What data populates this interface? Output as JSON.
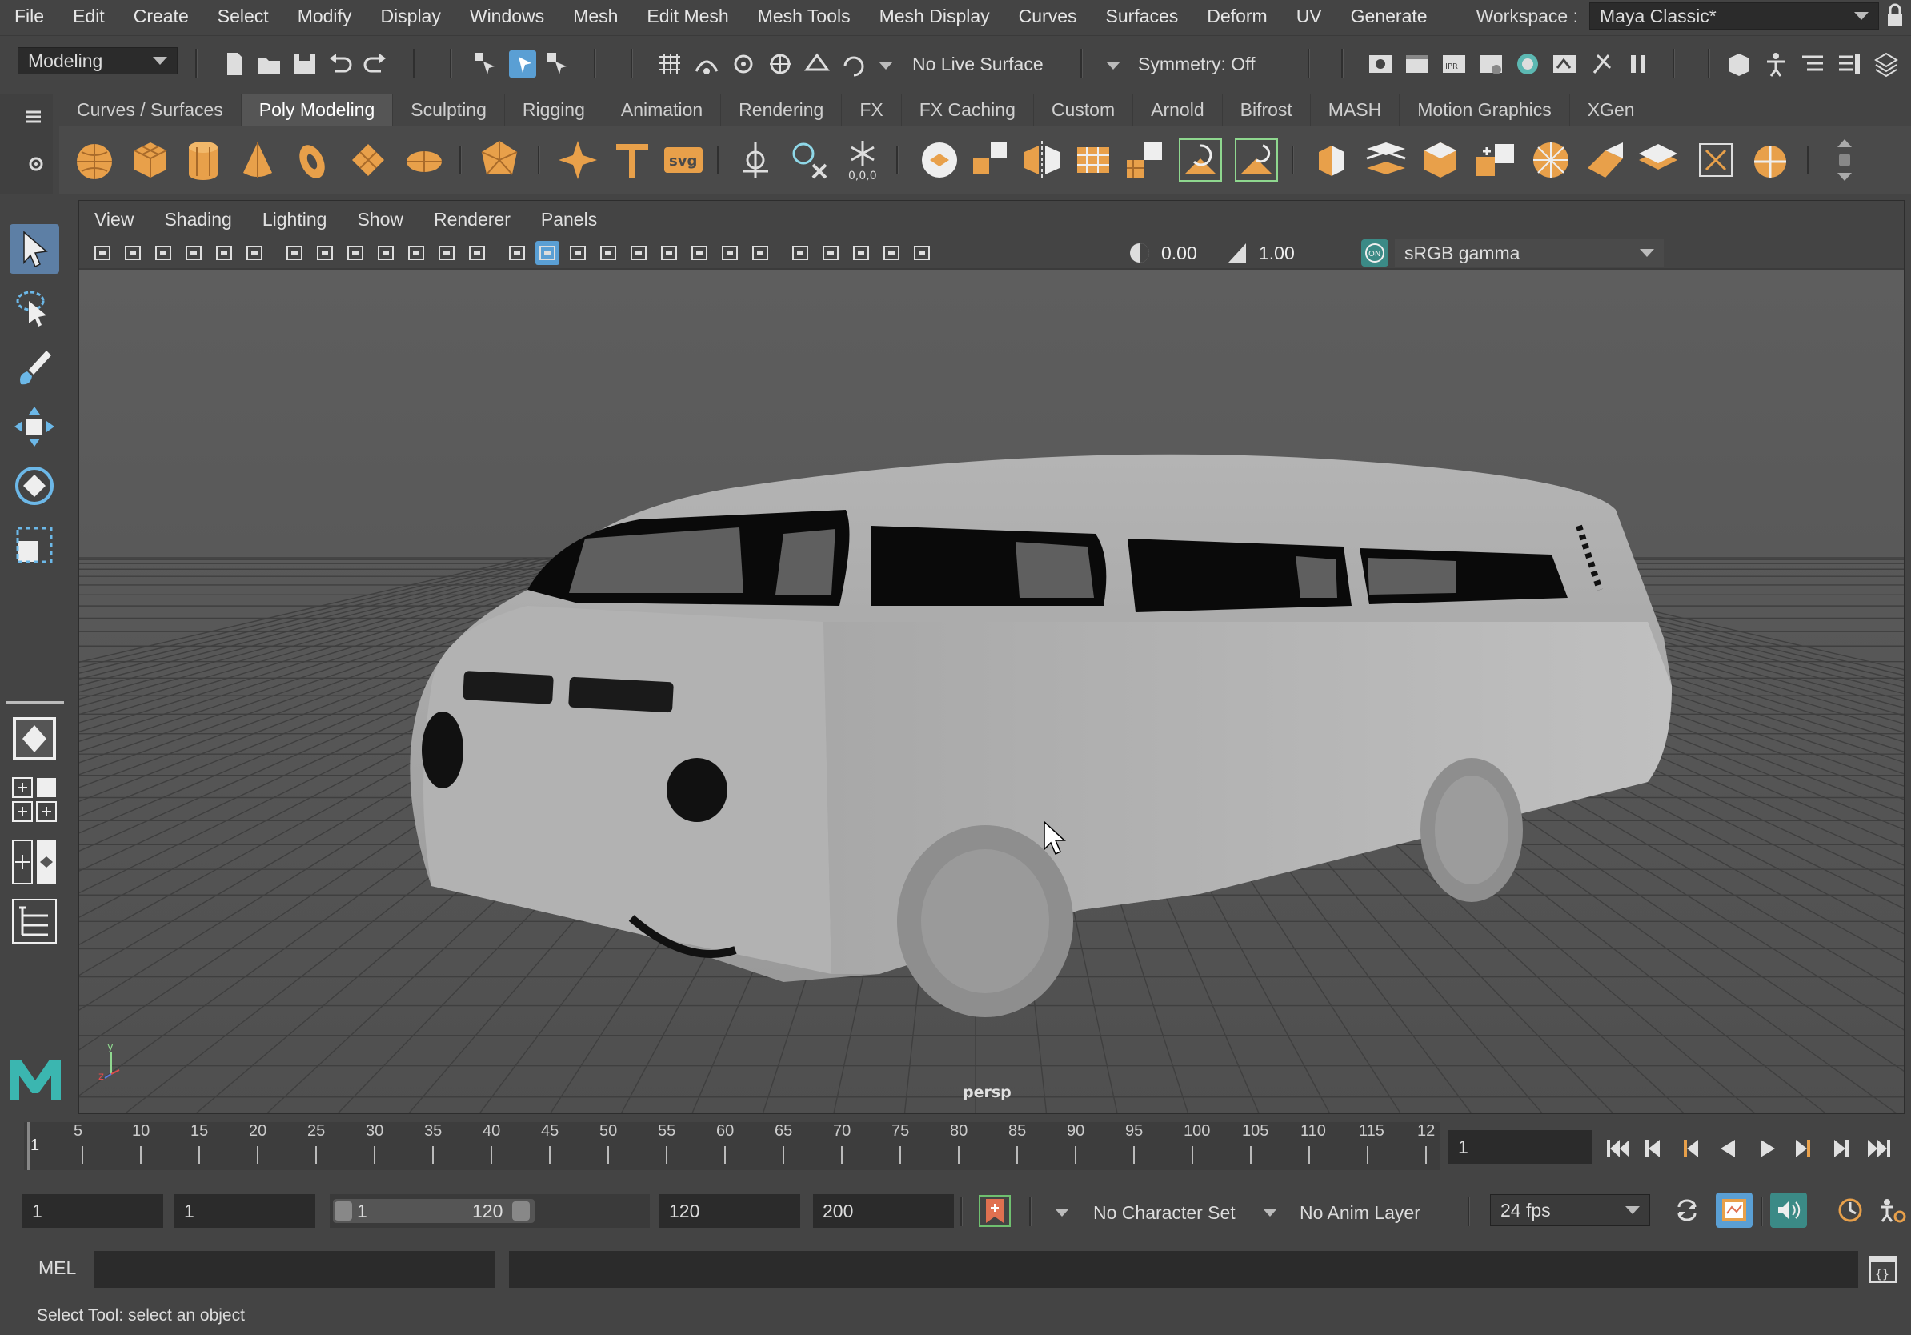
{
  "menubar": {
    "items": [
      "File",
      "Edit",
      "Create",
      "Select",
      "Modify",
      "Display",
      "Windows",
      "Mesh",
      "Edit Mesh",
      "Mesh Tools",
      "Mesh Display",
      "Curves",
      "Surfaces",
      "Deform",
      "UV",
      "Generate"
    ],
    "workspace_label": "Workspace :",
    "workspace_value": "Maya Classic*"
  },
  "statusline": {
    "menuset": "Modeling",
    "live_surface": "No Live Surface",
    "symmetry": "Symmetry: Off"
  },
  "shelf": {
    "tabs": [
      "Curves / Surfaces",
      "Poly Modeling",
      "Sculpting",
      "Rigging",
      "Animation",
      "Rendering",
      "FX",
      "FX Caching",
      "Custom",
      "Arnold",
      "Bifrost",
      "MASH",
      "Motion Graphics",
      "XGen"
    ],
    "active_tab": "Poly Modeling",
    "svg_label": "svg",
    "coords_label": "0,0,0"
  },
  "panel": {
    "menus": [
      "View",
      "Shading",
      "Lighting",
      "Show",
      "Renderer",
      "Panels"
    ],
    "exposure": "0.00",
    "gamma": "1.00",
    "colorspace": "sRGB gamma",
    "camera_label": "persp",
    "axis_y": "y",
    "axis_z": "z"
  },
  "timeline": {
    "ticks": [
      "5",
      "10",
      "15",
      "20",
      "25",
      "30",
      "35",
      "40",
      "45",
      "50",
      "55",
      "60",
      "65",
      "70",
      "75",
      "80",
      "85",
      "90",
      "95",
      "100",
      "105",
      "110",
      "115",
      "12"
    ],
    "start_marker": "1",
    "current_frame": "1"
  },
  "range": {
    "start": "1",
    "playback_start": "1",
    "slider_start": "1",
    "slider_end": "120",
    "playback_end": "120",
    "end": "200",
    "character_set": "No Character Set",
    "anim_layer": "No Anim Layer",
    "fps": "24 fps"
  },
  "cmdline": {
    "lang": "MEL"
  },
  "helpline": {
    "text": "Select Tool: select an object"
  },
  "colors": {
    "accent": "#e8a04a",
    "highlight": "#5a9fd4",
    "viewport": "#5a5a5a"
  }
}
